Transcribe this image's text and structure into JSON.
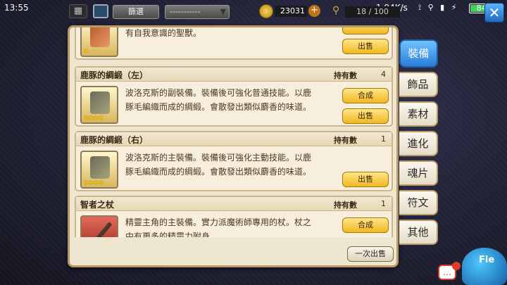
{
  "status_bar": {
    "time": "13:55",
    "net_speed": "1.94K/s",
    "icons": "⟟ ⚲ ▮ ⚡",
    "battery_percent": "84%"
  },
  "topbar": {
    "grid_icon": "grid-icon",
    "filter_label": "篩選",
    "sort_value": "-----------",
    "gold": "23031",
    "capacity": "18 / 100"
  },
  "items": [
    {
      "desc": "有自我意識的聖獸。",
      "stars": "★",
      "actions": [
        "出售"
      ]
    },
    {
      "name": "鹿豚的綢緞（左）",
      "hold_label": "持有數",
      "count": "4",
      "desc": [
        "波洛克斯的副裝備。裝備後可強化普通技能。以鹿",
        "豚毛編織而成的綢緞。會散發出類似麝香的味道。"
      ],
      "stars": "★★★★",
      "actions": [
        "合成",
        "出售"
      ]
    },
    {
      "name": "鹿豚的綢緞（右）",
      "hold_label": "持有數",
      "count": "1",
      "desc": [
        "波洛克斯的主裝備。裝備後可強化主動技能。以鹿",
        "豚毛編織而成的綢緞。會散發出類似麝香的味道。"
      ],
      "stars": "★★★★",
      "actions": [
        "出售"
      ]
    },
    {
      "name": "智者之杖",
      "hold_label": "持有數",
      "count": "1",
      "desc": [
        "精靈主角的主裝備。實力派魔術師專用的杖。杖之",
        "中有更多的精靈力附身。"
      ],
      "actions": [
        "合成"
      ]
    }
  ],
  "sell_all_label": "一次出售",
  "tabs": [
    "裝備",
    "飾品",
    "素材",
    "進化",
    "魂片",
    "符文",
    "其他"
  ],
  "close_label": "✕",
  "chat_label": "…",
  "mascot_label": "Fie"
}
